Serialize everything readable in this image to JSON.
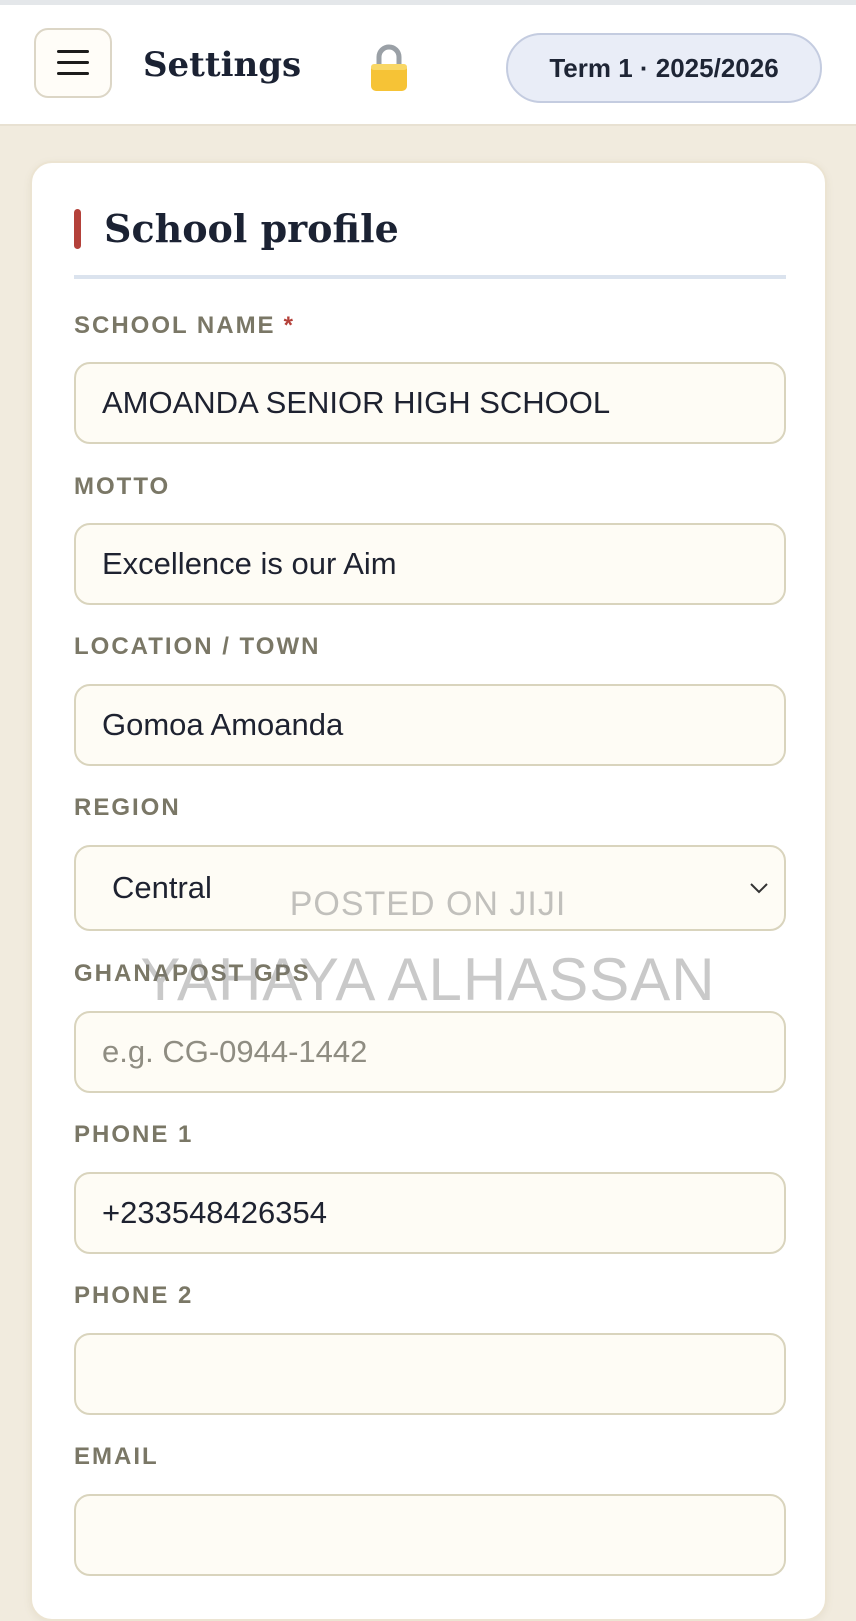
{
  "header": {
    "title": "Settings",
    "term_badge": "Term 1 · 2025/2026",
    "icons": [
      "menu-icon",
      "lock-icon"
    ]
  },
  "section": {
    "title": "School profile",
    "accent_color": "#b4413a"
  },
  "fields": {
    "school_name": {
      "label": "SCHOOL NAME",
      "required_mark": "*",
      "value": "AMOANDA SENIOR HIGH SCHOOL"
    },
    "motto": {
      "label": "MOTTO",
      "value": "Excellence is our Aim"
    },
    "location": {
      "label": "LOCATION / TOWN",
      "value": "Gomoa Amoanda"
    },
    "region": {
      "label": "REGION",
      "value": "Central"
    },
    "gps": {
      "label": "GHANAPOST GPS",
      "value": "",
      "placeholder": "e.g. CG-0944-1442"
    },
    "phone1": {
      "label": "PHONE 1",
      "value": "+233548426354"
    },
    "phone2": {
      "label": "PHONE 2",
      "value": ""
    },
    "email": {
      "label": "EMAIL",
      "value": ""
    }
  },
  "watermark": {
    "line1": "POSTED ON JIJI",
    "line2": "YAHAYA ALHASSAN"
  }
}
